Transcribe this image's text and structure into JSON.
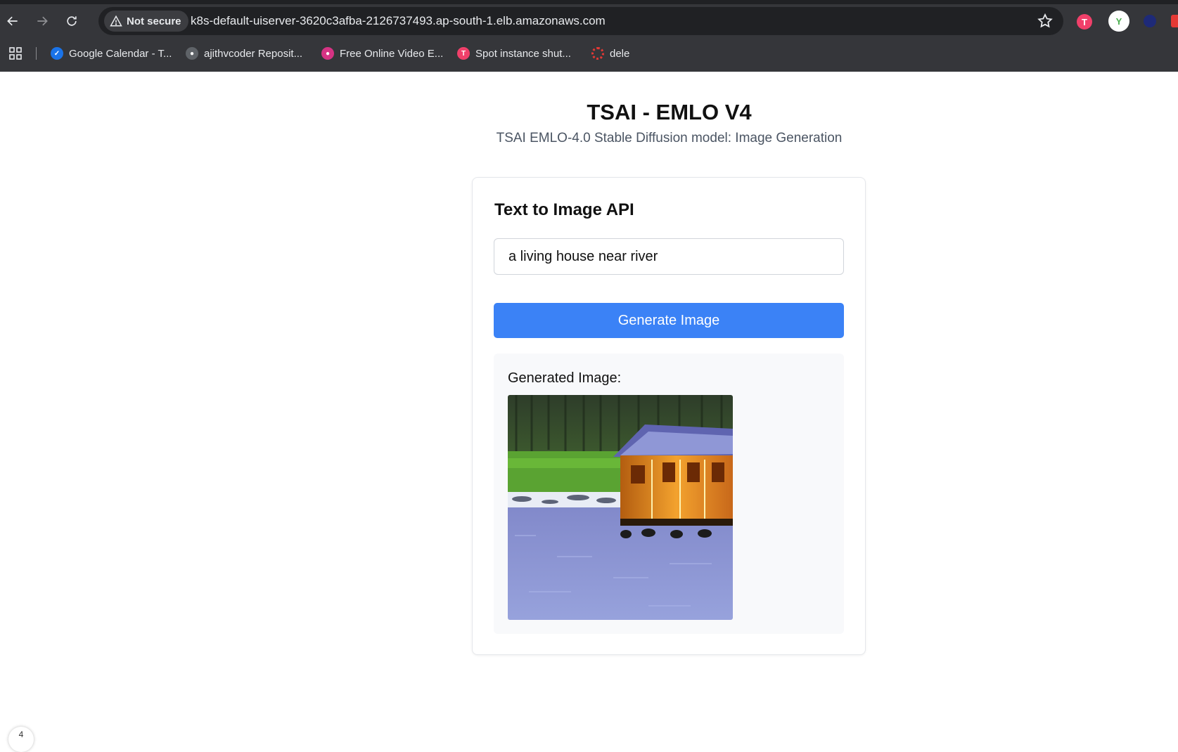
{
  "browser": {
    "security_chip": "Not secure",
    "url": "k8s-default-uiserver-3620c3afba-2126737493.ap-south-1.elb.amazonaws.com",
    "bookmarks": [
      {
        "label": "Google Calendar - T...",
        "icon": "google-calendar-icon",
        "color": "#1a73e8"
      },
      {
        "label": "ajithvcoder Reposit...",
        "icon": "github-icon",
        "color": "#5f6368"
      },
      {
        "label": "Free Online Video E...",
        "icon": "video-editor-icon",
        "color": "#d63384"
      },
      {
        "label": "Spot instance shut...",
        "icon": "tabnine-icon",
        "color": "#f0406a"
      },
      {
        "label": "dele",
        "icon": "lifebuoy-icon",
        "color": "#e53935"
      }
    ]
  },
  "page": {
    "title": "TSAI - EMLO V4",
    "subtitle": "TSAI EMLO-4.0 Stable Diffusion model: Image Generation"
  },
  "card": {
    "title": "Text to Image API",
    "prompt_value": "a living house near river",
    "generate_label": "Generate Image",
    "result_label": "Generated Image:"
  },
  "corner_badge": "4",
  "colors": {
    "primary_button": "#3b82f6",
    "chrome_bg": "#35363a",
    "omnibox_bg": "#202124"
  }
}
